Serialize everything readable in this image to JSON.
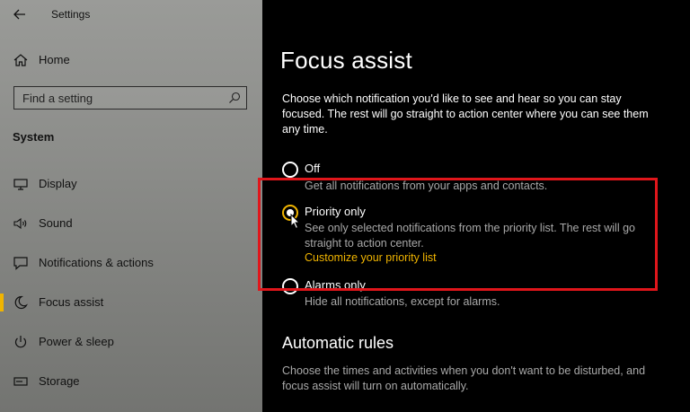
{
  "window": {
    "title": "Settings"
  },
  "sidebar": {
    "home_label": "Home",
    "search_placeholder": "Find a setting",
    "section": "System",
    "items": [
      {
        "label": "Display",
        "icon": "monitor-icon"
      },
      {
        "label": "Sound",
        "icon": "speaker-icon"
      },
      {
        "label": "Notifications & actions",
        "icon": "notifications-icon"
      },
      {
        "label": "Focus assist",
        "icon": "moon-icon",
        "selected": true
      },
      {
        "label": "Power & sleep",
        "icon": "power-icon"
      },
      {
        "label": "Storage",
        "icon": "storage-icon"
      }
    ]
  },
  "main": {
    "title": "Focus assist",
    "intro": "Choose which notification you'd like to see and hear so you can stay focused. The rest will go straight to action center where you can see them any time.",
    "options": [
      {
        "label": "Off",
        "description": "Get all notifications from your apps and contacts.",
        "checked": false
      },
      {
        "label": "Priority only",
        "description": "See only selected notifications from the priority list. The rest will go straight to action center.",
        "link": "Customize your priority list",
        "checked": true
      },
      {
        "label": "Alarms only",
        "description": "Hide all notifications, except for alarms.",
        "checked": false
      }
    ],
    "automatic_rules": {
      "title": "Automatic rules",
      "description": "Choose the times and activities when you don't want to be disturbed, and focus assist will turn on automatically."
    }
  },
  "colors": {
    "accent": "#f0b400",
    "highlight": "#e0161b",
    "background": "#000000"
  }
}
